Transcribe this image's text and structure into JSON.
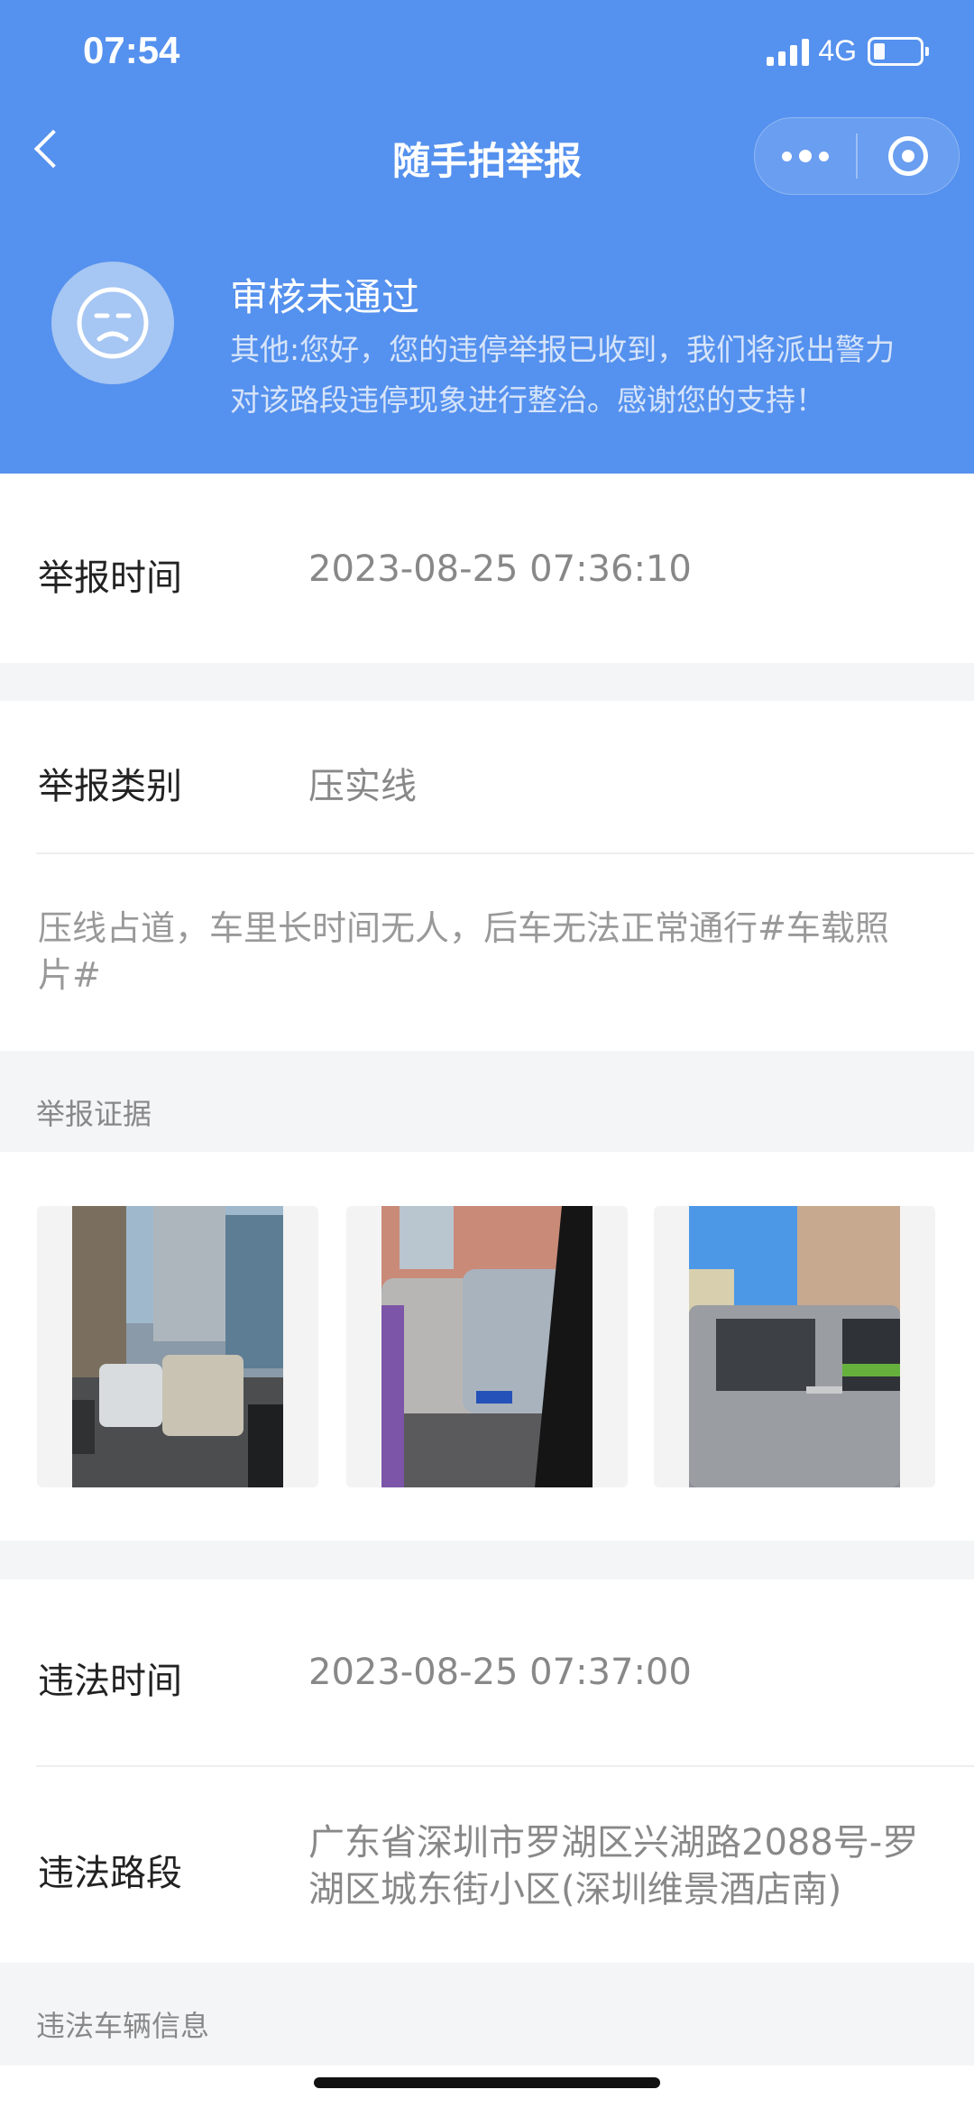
{
  "status_bar": {
    "time": "07:54",
    "network": "4G"
  },
  "nav": {
    "title": "随手拍举报"
  },
  "review": {
    "status": "审核未通过",
    "message": "其他:您好，您的违停举报已收到，我们将派出警力对该路段违停现象进行整治。感谢您的支持！"
  },
  "report_time": {
    "label": "举报时间",
    "value": "2023-08-25 07:36:10"
  },
  "category": {
    "label": "举报类别",
    "value": "压实线"
  },
  "description": "压线占道，车里长时间无人，后车无法正常通行#车载照片#",
  "evidence": {
    "label": "举报证据",
    "photo_count": 3
  },
  "violation_time": {
    "label": "违法时间",
    "value": "2023-08-25 07:37:00"
  },
  "violation_location": {
    "label": "违法路段",
    "value": "广东省深圳市罗湖区兴湖路2088号-罗湖区城东街小区(深圳维景酒店南)"
  },
  "vehicle_info": {
    "label": "违法车辆信息"
  },
  "colors": {
    "header": "#5591ee",
    "page_bg": "#f4f5f7"
  }
}
